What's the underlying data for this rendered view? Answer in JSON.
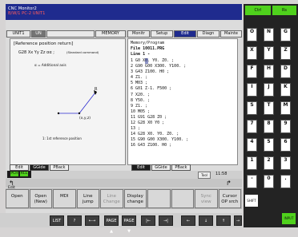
{
  "title": {
    "line1": "CNC Monitor2",
    "line2": "B/W/1 PC-2 UNIT1"
  },
  "tabs": [
    {
      "label": "UNIT1"
    },
    {
      "label": "UN"
    },
    {
      "label": ""
    },
    {
      "label": "MEMORY"
    },
    {
      "label": "Monitr"
    },
    {
      "label": "Setup"
    },
    {
      "label": "Edit"
    },
    {
      "label": "Diagn"
    },
    {
      "label": "Mainte"
    }
  ],
  "guide": {
    "heading": "[Reference position return]",
    "command": "G28 Xx Yy Zz αα ;",
    "command_note": "(Standard command)",
    "axis_note": "α = Additional axis",
    "points": {
      "r": "R",
      "start": "(x,y,z)"
    },
    "footnote": "1: 1st reference position"
  },
  "program": {
    "header": "Memory/Program",
    "file_label": "File",
    "file_value": "10011.PRG",
    "line_label": "Line",
    "line_value": "1 -",
    "lines": [
      "1 G0 X0. Y0. Z0. ;",
      "2 G90 G00 X300. Y100. ;",
      "3 G43 Z100. H0 ;",
      "4 Z1. ;",
      "5 M03 ;",
      "6 G01 Z-1. F500 ;",
      "7 X20. ;",
      "8 Y50. ;",
      "9 Z1. ;",
      "10 M05 ;",
      "11 G91 G28 Z0 ;",
      "12 G28 X0 Y0 ;",
      "13 ;",
      "14 G28 X0. Y0. Z0. ;",
      "15 G90 G00 X300. Y100. ;",
      "16 G43 Z100. H0 ;"
    ]
  },
  "panel_tabs_left": [
    "Edit",
    "GGide",
    "PBack"
  ],
  "panel_tabs_right": [
    "Edit",
    "GGide",
    "PBack"
  ],
  "status": {
    "mode1": "PCH",
    "mode2": "RCL",
    "tool_label": "Tool",
    "time": "11:58"
  },
  "softkeys": [
    {
      "label1": "Edit",
      "label2": "Open",
      "label3": ""
    },
    {
      "label1": "",
      "label2": "Open",
      "label3": "(New)"
    },
    {
      "label1": "",
      "label2": "MDI",
      "label3": ""
    },
    {
      "label1": "",
      "label2": "Line",
      "label3": "jump"
    },
    {
      "label1": "",
      "label2": "Line",
      "label3": "Change"
    },
    {
      "label1": "",
      "label2": "Display",
      "label3": "change"
    },
    {
      "label1": "",
      "label2": "",
      "label3": ""
    },
    {
      "label1": "",
      "label2": "",
      "label3": ""
    },
    {
      "label1": "",
      "label2": "Sync",
      "label3": "view"
    },
    {
      "label1": "",
      "label2": "Cursor",
      "label3": "OP srch"
    }
  ],
  "bottom_keys": [
    "LIST",
    "?",
    "←→",
    "PAGE ▲",
    "PAGE ▼",
    "|←",
    "→|",
    "←",
    "↓",
    "↑",
    "→"
  ],
  "keypad": {
    "top": [
      "Ctrl",
      "Rs"
    ],
    "rows": [
      [
        "O",
        "N",
        "G"
      ],
      [
        "X",
        "Y",
        "Z"
      ],
      [
        "F",
        "H",
        "D"
      ],
      [
        "I",
        "J",
        "K"
      ],
      [
        "S",
        "T",
        "M"
      ],
      [
        "7",
        "8",
        "9"
      ],
      [
        "4",
        "5",
        "6"
      ],
      [
        "1",
        "2",
        "3"
      ],
      [
        "-",
        "0",
        "."
      ]
    ],
    "bottom": [
      "SHIFT",
      "INPUT"
    ]
  },
  "colors": {
    "title_bg": "#1f2b8e",
    "status_green": "#4fd11c",
    "keypad_bg": "#232323"
  }
}
